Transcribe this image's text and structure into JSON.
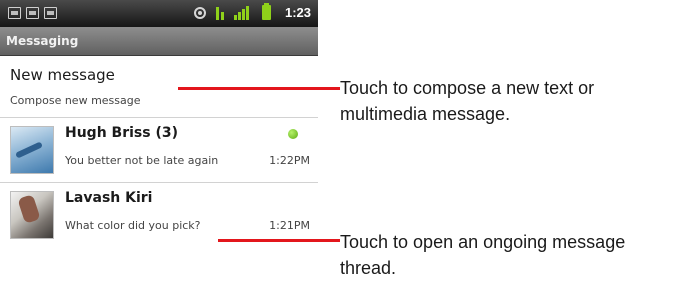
{
  "status_bar": {
    "time": "1:23",
    "icons": [
      "notification-icon",
      "notification-icon",
      "notification-icon",
      "gps-icon",
      "data-icon",
      "signal-icon",
      "battery-icon"
    ],
    "accent_color": "#8fd11a"
  },
  "title_bar": {
    "title": "Messaging"
  },
  "compose": {
    "title": "New message",
    "subtitle": "Compose new message"
  },
  "threads": [
    {
      "name": "Hugh Briss (3)",
      "snippet": "You better not be late again",
      "time": "1:22PM",
      "unread": true,
      "avatar": "sky-avatar"
    },
    {
      "name": "Lavash Kiri",
      "snippet": "What color did you pick?",
      "time": "1:21PM",
      "unread": false,
      "avatar": "photo-avatar"
    }
  ],
  "callouts": [
    {
      "text": "Touch to compose a new text or multimedia message."
    },
    {
      "text": "Touch to open an ongoing message thread."
    }
  ],
  "colors": {
    "callout_line": "#e3161c",
    "titlebar": "#7a7a7a",
    "statusbar": "#2a2a2a"
  }
}
